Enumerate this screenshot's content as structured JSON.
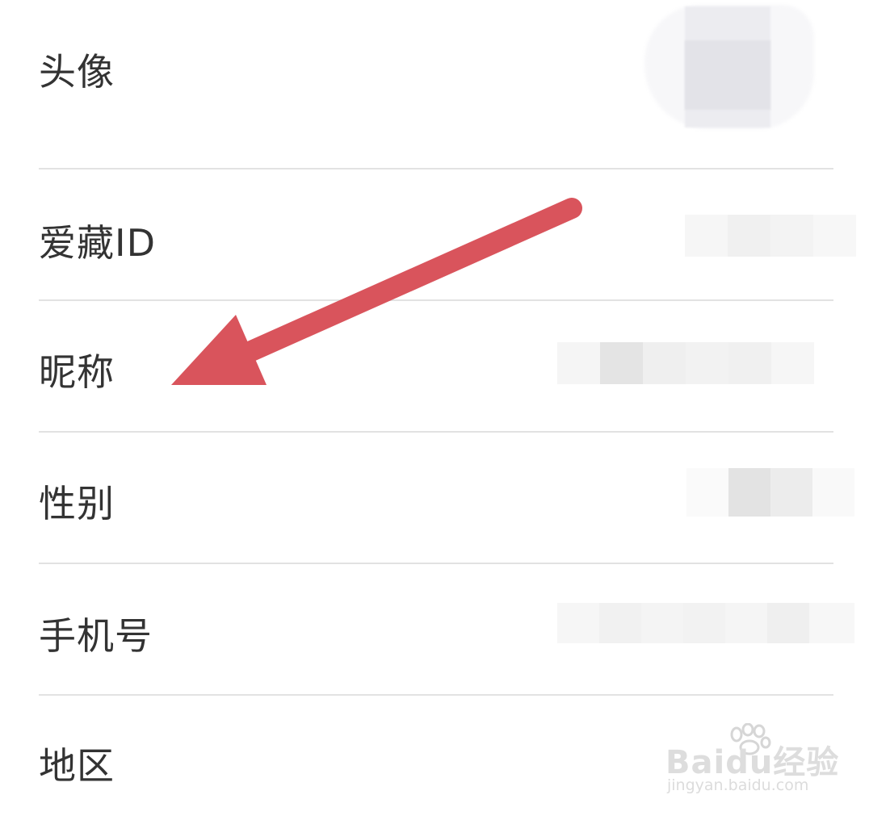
{
  "profile": {
    "rows": [
      {
        "key": "avatar",
        "label": "头像"
      },
      {
        "key": "id",
        "label": "爱藏ID"
      },
      {
        "key": "nickname",
        "label": "昵称"
      },
      {
        "key": "gender",
        "label": "性别"
      },
      {
        "key": "phone",
        "label": "手机号"
      },
      {
        "key": "region",
        "label": "地区"
      }
    ]
  },
  "annotation": {
    "arrow_color": "#d9545c",
    "points_to": "nickname"
  },
  "watermark": {
    "brand": "Baidu经验",
    "url": "jingyan.baidu.com"
  },
  "colors": {
    "text": "#333333",
    "divider": "#e2e2e2",
    "background": "#ffffff"
  }
}
